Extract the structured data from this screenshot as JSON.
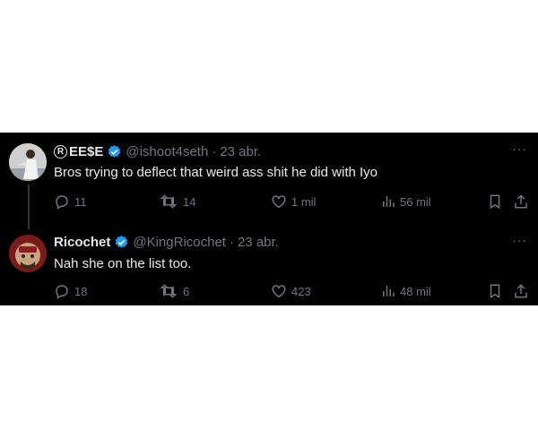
{
  "tweets": [
    {
      "name": "EE$E",
      "name_prefix": "R",
      "handle": "@ishoot4seth",
      "separator": "·",
      "date": "23 abr.",
      "text": "Bros trying to deflect that weird ass shit he did with Iyo",
      "replies": "11",
      "reposts": "14",
      "likes": "1 mil",
      "views": "56 mil",
      "more": "···"
    },
    {
      "name": "Ricochet",
      "handle": "@KingRicochet",
      "separator": "·",
      "date": "23 abr.",
      "text": "Nah she on the list too.",
      "replies": "18",
      "reposts": "6",
      "likes": "423",
      "views": "48 mil",
      "more": "···"
    }
  ],
  "colors": {
    "background": "#000000",
    "text": "#e7e9ea",
    "muted": "#71767b",
    "verified": "#1d9bf0"
  },
  "icons": [
    "reply-icon",
    "repost-icon",
    "like-icon",
    "views-icon",
    "bookmark-icon",
    "share-icon",
    "verified-icon",
    "more-icon"
  ]
}
